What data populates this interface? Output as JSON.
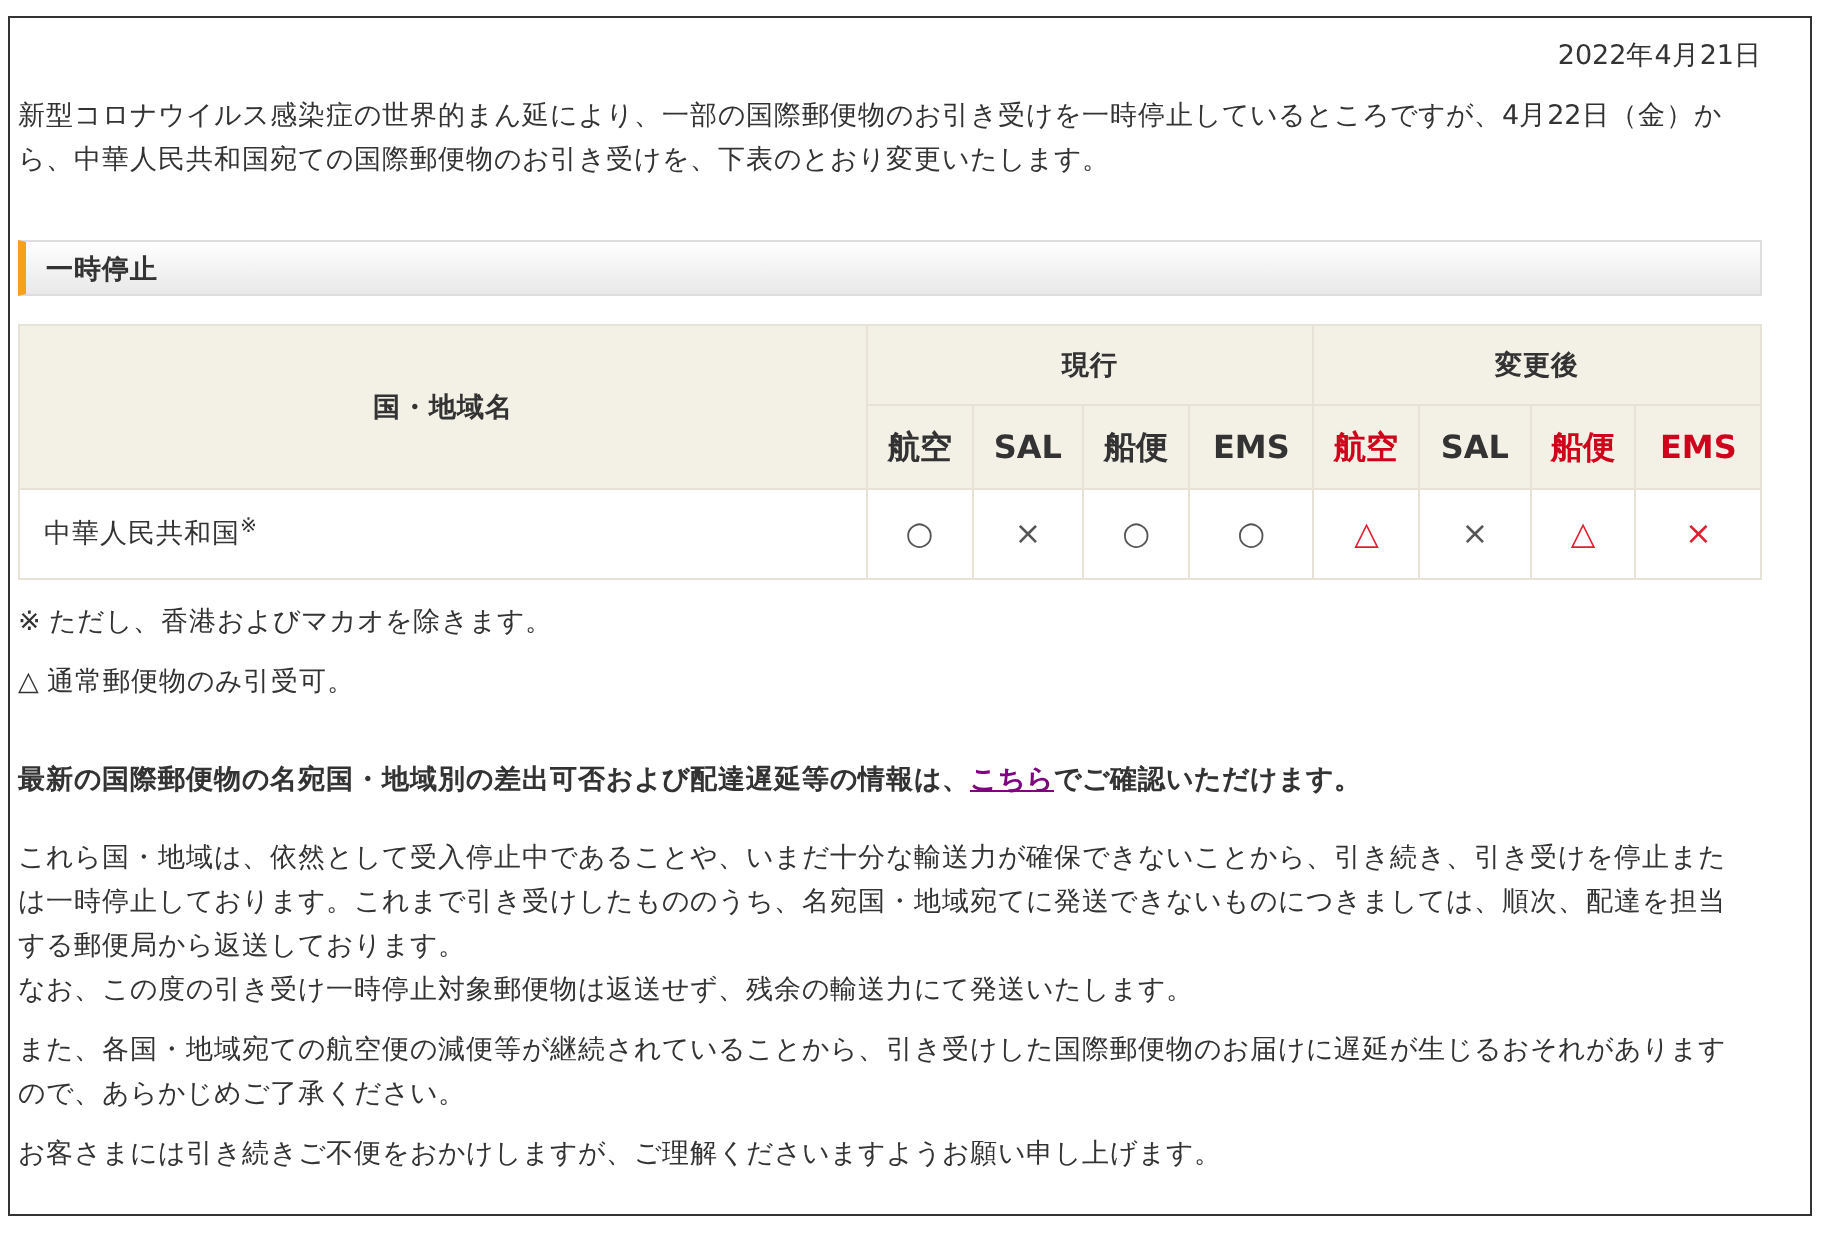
{
  "date": "2022年4月21日",
  "intro": "新型コロナウイルス感染症の世界的まん延により、一部の国際郵便物のお引き受けを一時停止しているところですが、4月22日（金）から、中華人民共和国宛ての国際郵便物のお引き受けを、下表のとおり変更いたします。",
  "section_heading": "一時停止",
  "table": {
    "name_header": "国・地域名",
    "groups": [
      {
        "label": "現行",
        "columns": [
          {
            "label": "航空",
            "alert": false
          },
          {
            "label": "SAL",
            "alert": false
          },
          {
            "label": "船便",
            "alert": false
          },
          {
            "label": "EMS",
            "alert": false
          }
        ]
      },
      {
        "label": "変更後",
        "columns": [
          {
            "label": "航空",
            "alert": true
          },
          {
            "label": "SAL",
            "alert": false
          },
          {
            "label": "船便",
            "alert": true
          },
          {
            "label": "EMS",
            "alert": true
          }
        ]
      }
    ],
    "rows": [
      {
        "name": "中華人民共和国$^{※}$",
        "cells": [
          {
            "mark": "○",
            "alert": false
          },
          {
            "mark": "×",
            "alert": false
          },
          {
            "mark": "○",
            "alert": false
          },
          {
            "mark": "○",
            "alert": false
          },
          {
            "mark": "△",
            "alert": true
          },
          {
            "mark": "×",
            "alert": false
          },
          {
            "mark": "△",
            "alert": true
          },
          {
            "mark": "×",
            "alert": true
          }
        ]
      }
    ]
  },
  "notes": [
    "※ ただし、香港およびマカオを除きます。",
    "△ 通常郵便物のみ引受可。"
  ],
  "info": {
    "before": "最新の国際郵便物の名宛国・地域別の差出可否および配達遅延等の情報は、",
    "link": "こちら",
    "after": "でご確認いただけます。"
  },
  "paragraphs": [
    [
      "これら国・地域は、依然として受入停止中であることや、いまだ十分な輸送力が確保できないことから、引き続き、引き受けを停止または一時停止しております。これまで引き受けしたもののうち、名宛国・地域宛てに発送できないものにつきましては、順次、配達を担当する郵便局から返送しております。",
      "なお、この度の引き受け一時停止対象郵便物は返送せず、残余の輸送力にて発送いたします。"
    ],
    [
      "また、各国・地域宛ての航空便の減便等が継続されていることから、引き受けした国際郵便物のお届けに遅延が生じるおそれがありますので、あらかじめご了承ください。"
    ],
    [
      "お客さまには引き続きご不便をおかけしますが、ご理解くださいますようお願い申し上げます。"
    ]
  ]
}
